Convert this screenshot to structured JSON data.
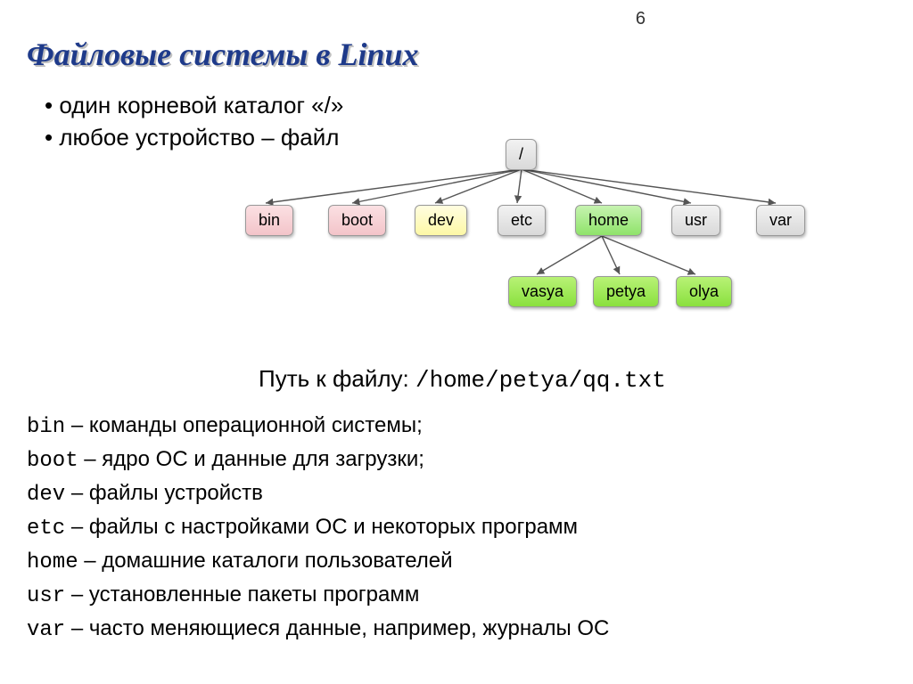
{
  "page_number": "6",
  "title": "Файловые системы в Linux",
  "bullets": [
    "один корневой каталог «/»",
    "любое устройство – файл"
  ],
  "tree": {
    "root": "/",
    "level1": [
      "bin",
      "boot",
      "dev",
      "etc",
      "home",
      "usr",
      "var"
    ],
    "level2": [
      "vasya",
      "petya",
      "olya"
    ]
  },
  "path_label": "Путь к файлу: ",
  "path_value": "/home/petya/qq.txt",
  "definitions": [
    {
      "key": "bin",
      "sep": " – ",
      "desc": "команды операционной системы;"
    },
    {
      "key": "boot",
      "sep": " – ",
      "desc": "ядро ОС и данные для загрузки;"
    },
    {
      "key": "dev",
      "sep": " – ",
      "desc": "файлы устройств"
    },
    {
      "key": "etc",
      "sep": " – ",
      "desc": "файлы с настройками ОС и некоторых программ"
    },
    {
      "key": "home",
      "sep": " – ",
      "desc": "домашние каталоги пользователей"
    },
    {
      "key": "usr",
      "sep": " – ",
      "desc": "установленные пакеты программ"
    },
    {
      "key": "var",
      "sep": " – ",
      "desc": "часто меняющиеся данные,  например, журналы ОС"
    }
  ]
}
